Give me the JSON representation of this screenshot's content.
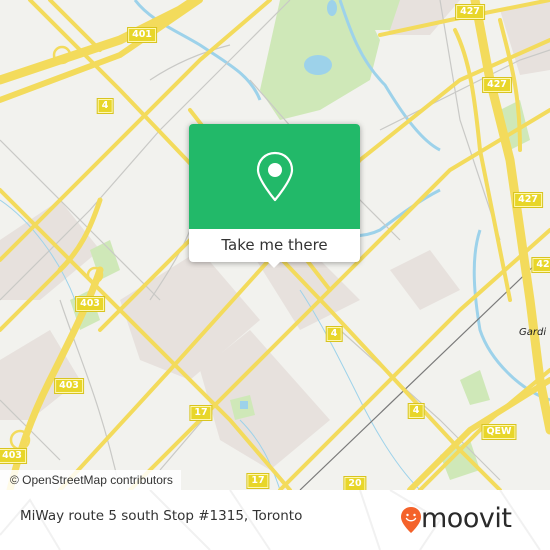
{
  "map": {
    "attribution": "© OpenStreetMap contributors",
    "place_labels": [
      {
        "name": "gardiner-label",
        "text": "Gardi"
      }
    ],
    "highway_shields": [
      {
        "id": "401",
        "text": "401"
      },
      {
        "id": "427-top",
        "text": "427"
      },
      {
        "id": "427-mid",
        "text": "427"
      },
      {
        "id": "427-right",
        "text": "427"
      },
      {
        "id": "42x-right",
        "text": "42"
      },
      {
        "id": "4-nw",
        "text": "4"
      },
      {
        "id": "4-center",
        "text": "4"
      },
      {
        "id": "4-east",
        "text": "4"
      },
      {
        "id": "403-a",
        "text": "403"
      },
      {
        "id": "403-b",
        "text": "403"
      },
      {
        "id": "403-c",
        "text": "403"
      },
      {
        "id": "17-a",
        "text": "17"
      },
      {
        "id": "17-b",
        "text": "17"
      },
      {
        "id": "20",
        "text": "20"
      },
      {
        "id": "qew",
        "text": "QEW"
      }
    ],
    "colors": {
      "background": "#f2f2ee",
      "major_road": "#f5dc5a",
      "minor_road": "#c8c8c8",
      "water": "#9cd3ec",
      "park": "#cde8b4",
      "residential": "#e6e0dc"
    }
  },
  "popup": {
    "icon": "map-pin-icon",
    "button_label": "Take me there",
    "accent_color": "#22b969"
  },
  "footer": {
    "title": "MiWay route 5 south Stop #1315, Toronto",
    "logo_text": "moovit",
    "logo_icon": "moovit-pin-smile-icon",
    "logo_color": "#f4622a"
  }
}
